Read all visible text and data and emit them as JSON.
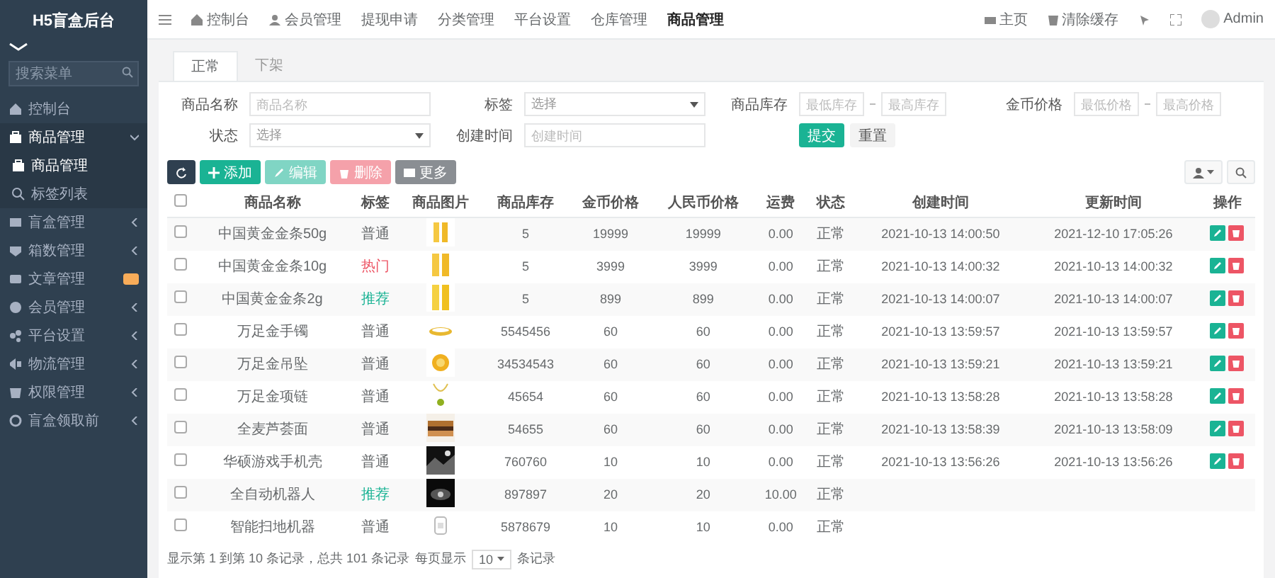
{
  "sidebar": {
    "title": "H5盲盒后台",
    "search": {
      "placeholder": "搜索菜单"
    },
    "items": [
      {
        "label": "控制台",
        "expanded": false,
        "selected": false
      },
      {
        "label": "商品管理",
        "expanded": true,
        "selected": false,
        "children": [
          {
            "label": "商品管理",
            "selected": true
          },
          {
            "label": "标签列表",
            "selected": false
          }
        ]
      },
      {
        "label": "盲盒管理",
        "expanded": false,
        "selected": false
      },
      {
        "label": "箱数管理",
        "expanded": false,
        "selected": false
      },
      {
        "label": "文章管理",
        "expanded": false,
        "selected": false,
        "badge": true
      },
      {
        "label": "会员管理",
        "expanded": false,
        "selected": false
      },
      {
        "label": "平台设置",
        "expanded": false,
        "selected": false
      },
      {
        "label": "物流管理",
        "expanded": false,
        "selected": false
      },
      {
        "label": "权限管理",
        "expanded": false,
        "selected": false
      },
      {
        "label": "盲盒领取前",
        "expanded": false,
        "selected": false
      }
    ]
  },
  "topnav": {
    "items": [
      {
        "label": "控制台",
        "selected": false
      },
      {
        "label": "会员管理",
        "selected": false
      },
      {
        "label": "提现申请",
        "selected": false
      },
      {
        "label": "分类管理",
        "selected": false
      },
      {
        "label": "平台设置",
        "selected": false
      },
      {
        "label": "仓库管理",
        "selected": false
      },
      {
        "label": "商品管理",
        "selected": true
      }
    ],
    "home": "主页",
    "clear_cache": "清除缓存",
    "user": "Admin"
  },
  "tabs": [
    {
      "label": "正常",
      "selected": true
    },
    {
      "label": "下架",
      "selected": false
    }
  ],
  "filters": [
    {
      "kind": "text",
      "label": "商品名称",
      "placeholder": "商品名称"
    },
    {
      "kind": "select",
      "label": "标签",
      "value": "选择"
    },
    {
      "kind": "range",
      "label": "商品库存",
      "placeholder": "最低库存",
      "placeholder_to": "最高库存"
    },
    {
      "kind": "range",
      "label": "金币价格",
      "placeholder": "最低价格",
      "placeholder_to": "最高价格"
    },
    {
      "kind": "select",
      "label": "状态",
      "value": "选择"
    },
    {
      "kind": "text",
      "label": "创建时间",
      "placeholder": "创建时间"
    }
  ],
  "filter_buttons": {
    "submit": "提交",
    "reset": "重置"
  },
  "toolbar": [
    {
      "kind": "refresh",
      "disabled": false
    },
    {
      "kind": "add",
      "label": "添加",
      "disabled": false
    },
    {
      "kind": "edit",
      "label": "编辑",
      "disabled": true
    },
    {
      "kind": "delete",
      "label": "删除",
      "disabled": true
    },
    {
      "kind": "more",
      "label": "更多",
      "disabled": false
    }
  ],
  "table": {
    "all_checked": false,
    "columns": [
      "商品名称",
      "标签",
      "商品图片",
      "商品库存",
      "金币价格",
      "人民币价格",
      "运费",
      "状态",
      "创建时间",
      "更新时间",
      "操作"
    ],
    "rows": [
      {
        "checked": false,
        "name": "中国黄金金条50g",
        "tag": {
          "text": "普通",
          "color": "#676a6c"
        },
        "stock": "5",
        "gold": "19999",
        "rmb": "19999",
        "freight": "0.00",
        "status": "正常",
        "created": "2021-10-13 14:00:50",
        "updated": "2021-12-10 17:05:26",
        "actions": true
      },
      {
        "checked": false,
        "name": "中国黄金金条10g",
        "tag": {
          "text": "热门",
          "color": "#ed5565"
        },
        "stock": "5",
        "gold": "3999",
        "rmb": "3999",
        "freight": "0.00",
        "status": "正常",
        "created": "2021-10-13 14:00:32",
        "updated": "2021-10-13 14:00:32",
        "actions": true
      },
      {
        "checked": false,
        "name": "中国黄金金条2g",
        "tag": {
          "text": "推荐",
          "color": "#1ab394"
        },
        "stock": "5",
        "gold": "899",
        "rmb": "899",
        "freight": "0.00",
        "status": "正常",
        "created": "2021-10-13 14:00:07",
        "updated": "2021-10-13 14:00:07",
        "actions": true
      },
      {
        "checked": false,
        "name": "万足金手镯",
        "tag": {
          "text": "普通",
          "color": "#676a6c"
        },
        "stock": "5545456",
        "gold": "60",
        "rmb": "60",
        "freight": "0.00",
        "status": "正常",
        "created": "2021-10-13 13:59:57",
        "updated": "2021-10-13 13:59:57",
        "actions": true
      },
      {
        "checked": false,
        "name": "万足金吊坠",
        "tag": {
          "text": "普通",
          "color": "#676a6c"
        },
        "stock": "34534543",
        "gold": "60",
        "rmb": "60",
        "freight": "0.00",
        "status": "正常",
        "created": "2021-10-13 13:59:21",
        "updated": "2021-10-13 13:59:21",
        "actions": true
      },
      {
        "checked": false,
        "name": "万足金项链",
        "tag": {
          "text": "普通",
          "color": "#676a6c"
        },
        "stock": "45654",
        "gold": "60",
        "rmb": "60",
        "freight": "0.00",
        "status": "正常",
        "created": "2021-10-13 13:58:28",
        "updated": "2021-10-13 13:58:28",
        "actions": true
      },
      {
        "checked": false,
        "name": "全麦芦荟面",
        "tag": {
          "text": "普通",
          "color": "#676a6c"
        },
        "stock": "54655",
        "gold": "60",
        "rmb": "60",
        "freight": "0.00",
        "status": "正常",
        "created": "2021-10-13 13:58:39",
        "updated": "2021-10-13 13:58:09",
        "actions": true
      },
      {
        "checked": false,
        "name": "华硕游戏手机壳",
        "tag": {
          "text": "普通",
          "color": "#676a6c"
        },
        "stock": "760760",
        "gold": "10",
        "rmb": "10",
        "freight": "0.00",
        "status": "正常",
        "created": "2021-10-13 13:56:26",
        "updated": "2021-10-13 13:56:26",
        "actions": true
      },
      {
        "checked": false,
        "name": "全自动机器人",
        "tag": {
          "text": "推荐",
          "color": "#1ab394"
        },
        "stock": "897897",
        "gold": "20",
        "rmb": "20",
        "freight": "10.00",
        "status": "正常",
        "actions": false
      },
      {
        "checked": false,
        "name": "智能扫地机器",
        "tag": {
          "text": "普通",
          "color": "#676a6c"
        },
        "stock": "5878679",
        "gold": "10",
        "rmb": "10",
        "freight": "0.00",
        "status": "正常",
        "actions": false
      }
    ]
  },
  "pagination": {
    "summary": "显示第 1 到第 10 条记录，总共 101 条记录",
    "per_page_label": "每页显示",
    "per_page": "10",
    "suffix": "条记录"
  }
}
